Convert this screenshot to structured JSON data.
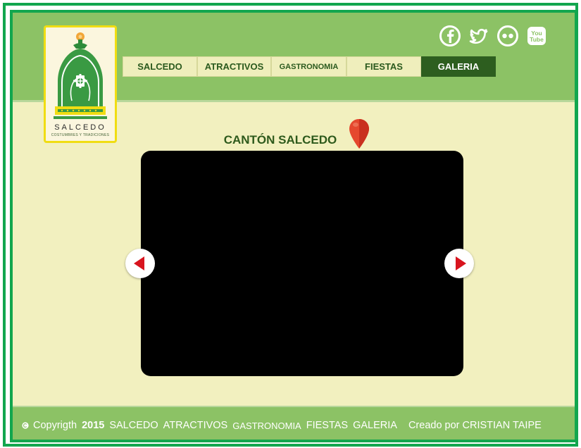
{
  "logo": {
    "title": "SALCEDO",
    "subtitle": "COSTUMBRES Y TRADICIONES"
  },
  "nav": {
    "items": [
      {
        "label": "SALCEDO",
        "active": false
      },
      {
        "label": "ATRACTIVOS",
        "active": false
      },
      {
        "label": "GASTRONOMIA",
        "active": false
      },
      {
        "label": "FIESTAS",
        "active": false
      },
      {
        "label": "GALERIA",
        "active": true
      }
    ]
  },
  "social": {
    "facebook_icon": "facebook-icon",
    "twitter_icon": "twitter-icon",
    "flickr_icon": "flickr-icon",
    "youtube_icon": "youtube-icon",
    "youtube_text_1": "You",
    "youtube_text_2": "Tube"
  },
  "gallery": {
    "title": "CANTÓN SALCEDO",
    "pin_icon": "map-pin-icon",
    "prev_icon": "arrow-left-icon",
    "next_icon": "arrow-right-icon"
  },
  "footer": {
    "copyright": "Copyrigth",
    "year": "2015",
    "links": [
      "SALCEDO",
      "ATRACTIVOS",
      "GASTRONOMIA",
      "FIESTAS",
      "GALERIA"
    ],
    "credit": "Creado por CRISTIAN TAIPE"
  },
  "colors": {
    "header_green": "#8cc265",
    "frame_green": "#12a64e",
    "background_cream": "#f2f0bf",
    "active_tab": "#2d5e1f",
    "arrow_red": "#d8141e"
  }
}
